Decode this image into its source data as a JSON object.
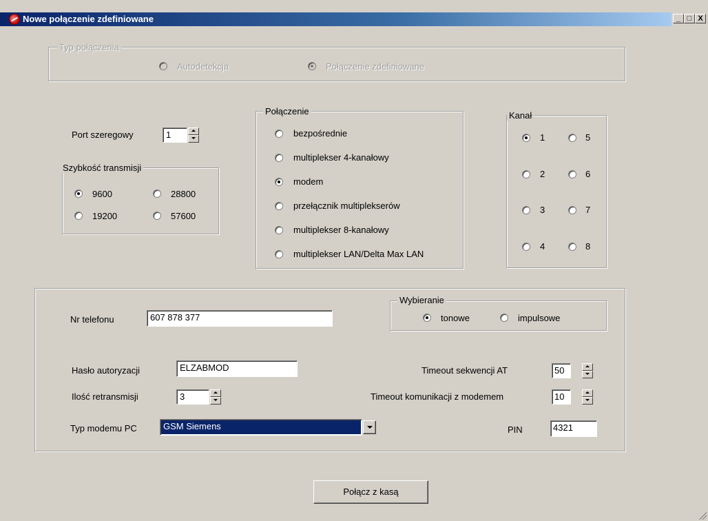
{
  "window": {
    "title": "Nowe połączenie zdefiniowane",
    "minimize_glyph": "_",
    "maximize_glyph": "□",
    "close_glyph": "X"
  },
  "connection_type": {
    "legend": "Typ połączenia",
    "options": [
      {
        "label": "Autodetekcja",
        "checked": false
      },
      {
        "label": "Połączenie zdefiniowane",
        "checked": true
      }
    ]
  },
  "serial_port": {
    "label": "Port szeregowy",
    "value": "1"
  },
  "baud": {
    "legend": "Szybkość transmisji",
    "options": [
      {
        "label": "9600",
        "checked": true
      },
      {
        "label": "28800",
        "checked": false
      },
      {
        "label": "19200",
        "checked": false
      },
      {
        "label": "57600",
        "checked": false
      }
    ]
  },
  "connection": {
    "legend": "Połączenie",
    "options": [
      {
        "label": "bezpośrednie",
        "checked": false
      },
      {
        "label": "multiplekser 4-kanałowy",
        "checked": false
      },
      {
        "label": "modem",
        "checked": true
      },
      {
        "label": "przełącznik multiplekserów",
        "checked": false
      },
      {
        "label": "multiplekser 8-kanałowy",
        "checked": false
      },
      {
        "label": "multiplekser LAN/Delta Max LAN",
        "checked": false
      }
    ]
  },
  "channel": {
    "legend": "Kanał",
    "options": [
      {
        "label": "1",
        "checked": true
      },
      {
        "label": "5",
        "checked": false
      },
      {
        "label": "2",
        "checked": false
      },
      {
        "label": "6",
        "checked": false
      },
      {
        "label": "3",
        "checked": false
      },
      {
        "label": "7",
        "checked": false
      },
      {
        "label": "4",
        "checked": false
      },
      {
        "label": "8",
        "checked": false
      }
    ]
  },
  "modem": {
    "phone_label": "Nr telefonu",
    "phone_value": "607 878 377",
    "dialing": {
      "legend": "Wybieranie",
      "options": [
        {
          "label": "tonowe",
          "checked": true
        },
        {
          "label": "impulsowe",
          "checked": false
        }
      ]
    },
    "auth_label": "Hasło autoryzacji",
    "auth_value": "ELZABMOD",
    "retrans_label": "Ilość retransmisji",
    "retrans_value": "3",
    "modem_type_label": "Typ modemu PC",
    "modem_type_value": "GSM Siemens",
    "at_timeout_label": "Timeout sekwencji AT",
    "at_timeout_value": "50",
    "comm_timeout_label": "Timeout komunikacji z modemem",
    "comm_timeout_value": "10",
    "pin_label": "PIN",
    "pin_value": "4321"
  },
  "connect_button": "Połącz z kasą",
  "colors": {
    "face": "#d4d0c8",
    "title_start": "#0a246a",
    "title_end": "#a6caf0",
    "selection": "#0a246a"
  }
}
